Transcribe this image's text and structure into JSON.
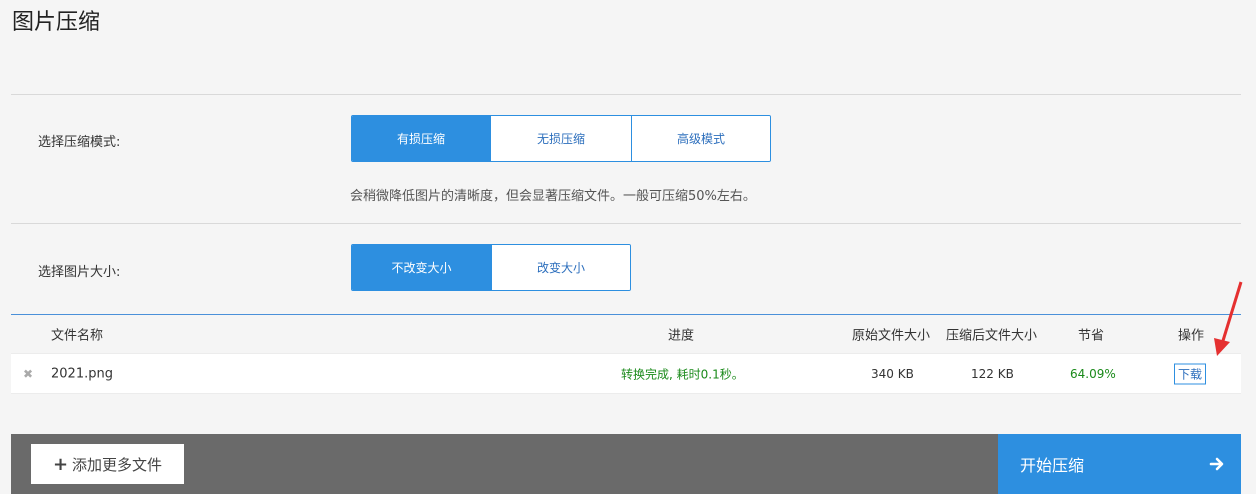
{
  "page": {
    "title": "图片压缩"
  },
  "mode": {
    "label": "选择压缩模式:",
    "options": [
      "有损压缩",
      "无损压缩",
      "高级模式"
    ],
    "selected": "有损压缩",
    "hint": "会稍微降低图片的清晰度，但会显著压缩文件。一般可压缩50%左右。"
  },
  "size": {
    "label": "选择图片大小:",
    "options": [
      "不改变大小",
      "改变大小"
    ],
    "selected": "不改变大小"
  },
  "table": {
    "headers": {
      "name": "文件名称",
      "progress": "进度",
      "original": "原始文件大小",
      "compressed": "压缩后文件大小",
      "saved": "节省",
      "action": "操作"
    },
    "rows": [
      {
        "name": "2021.png",
        "progress": "转换完成, 耗时0.1秒。",
        "original": "340 KB",
        "compressed": "122 KB",
        "saved": "64.09%",
        "action": "下载"
      }
    ]
  },
  "footer": {
    "add_label": "添加更多文件",
    "start_label": "开始压缩"
  },
  "colors": {
    "accent": "#2d8fe0",
    "success": "#1a8a1a",
    "annotation": "#e53030"
  },
  "icons": {
    "remove": "close-icon",
    "add": "plus-icon",
    "start": "arrow-right-icon"
  }
}
